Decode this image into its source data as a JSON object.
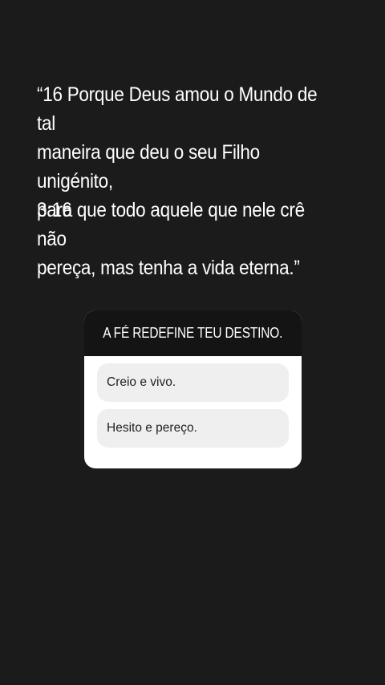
{
  "story": {
    "quote": "“16 Porque Deus amou o Mundo de tal\nmaneira que deu o seu Filho unigénito,\npara que todo aquele que nele crê não\npereça, mas tenha a vida eterna.”",
    "reference": "3:16"
  },
  "poll": {
    "question": "A FÉ REDEFINE TEU DESTINO.",
    "options": [
      {
        "label": "Creio e vivo."
      },
      {
        "label": "Hesito e pereço."
      }
    ]
  },
  "colors": {
    "background": "#1b1b1b",
    "poll_header": "#141414",
    "option_background": "#efefef"
  }
}
